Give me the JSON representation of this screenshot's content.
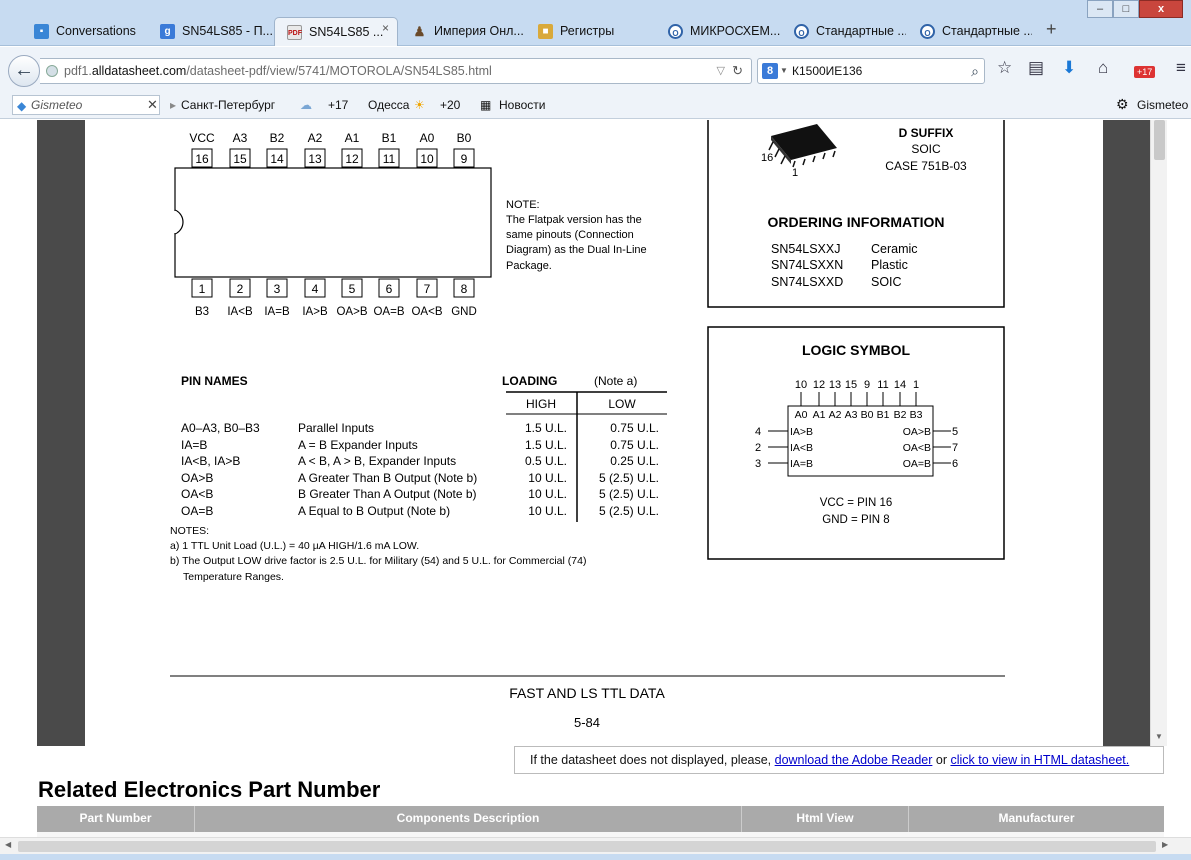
{
  "tabs": [
    {
      "label": "Conversations",
      "icon": "chat-icon"
    },
    {
      "label": "SN54LS85 - П...",
      "icon": "google-icon"
    },
    {
      "label": "SN54LS85 ...",
      "icon": "pdf-icon",
      "active": true
    },
    {
      "label": "Империя Онл...",
      "icon": "figure-icon"
    },
    {
      "label": "Регистры",
      "icon": "package-icon"
    },
    {
      "label": "МИКРОСХЕМ...",
      "icon": "opera-icon"
    },
    {
      "label": "Стандартные ...",
      "icon": "opera-icon"
    },
    {
      "label": "Стандартные ...",
      "icon": "opera-icon"
    }
  ],
  "tab_close_glyph": "×",
  "new_tab_glyph": "+",
  "window": {
    "minimize": "–",
    "maximize": "□",
    "close": "x"
  },
  "nav": {
    "url_scheme_host_prefix": "pdf1.",
    "url_host": "alldatasheet.com",
    "url_path": "/datasheet-pdf/view/5741/MOTOROLA/SN54LS85.html",
    "search_engine_letter": "8",
    "search_value": "К1500ИЕ136",
    "download_badge": "+17"
  },
  "bookmarks": {
    "gismeteo_placeholder": "Gismeteo",
    "items": [
      {
        "label": "Санкт-Петербург"
      },
      {
        "label": "+17"
      },
      {
        "label": "Одесса"
      },
      {
        "label": "+20"
      },
      {
        "label": "Новости"
      },
      {
        "label": "Gismeteo"
      }
    ]
  },
  "chip": {
    "top_pin_labels": [
      "VCC",
      "A3",
      "B2",
      "A2",
      "A1",
      "B1",
      "A0",
      "B0"
    ],
    "top_pin_numbers": [
      "16",
      "15",
      "14",
      "13",
      "12",
      "11",
      "10",
      "9"
    ],
    "bottom_pin_numbers": [
      "1",
      "2",
      "3",
      "4",
      "5",
      "6",
      "7",
      "8"
    ],
    "bottom_pin_labels": [
      "B3",
      "IA<B",
      "IA=B",
      "IA>B",
      "OA>B",
      "OA=B",
      "OA<B",
      "GND"
    ],
    "note_title": "NOTE:",
    "note_lines": [
      "The Flatpak version has the",
      "same pinouts (Connection",
      "Diagram) as the Dual In-Line",
      "Package."
    ]
  },
  "package": {
    "pin16": "16",
    "pin1": "1",
    "suffix": "D SUFFIX",
    "type": "SOIC",
    "case": "CASE 751B-03",
    "ordering_title": "ORDERING INFORMATION",
    "ordering": [
      {
        "part": "SN54LSXXJ",
        "package": "Ceramic"
      },
      {
        "part": "SN74LSXXN",
        "package": "Plastic"
      },
      {
        "part": "SN74LSXXD",
        "package": "SOIC"
      }
    ]
  },
  "pin_names": {
    "title": "PIN NAMES",
    "loading_title": "LOADING",
    "loading_note": "(Note a)",
    "col_high": "HIGH",
    "col_low": "LOW",
    "rows": [
      {
        "pin": "A0–A3, B0–B3",
        "desc": "Parallel Inputs",
        "high": "1.5 U.L.",
        "low": "0.75 U.L."
      },
      {
        "pin": "IA=B",
        "desc": "A = B Expander Inputs",
        "high": "1.5 U.L.",
        "low": "0.75 U.L."
      },
      {
        "pin": "IA<B, IA>B",
        "desc": "A < B, A > B, Expander Inputs",
        "high": "0.5 U.L.",
        "low": "0.25 U.L."
      },
      {
        "pin": "OA>B",
        "desc": "A Greater Than B Output (Note b)",
        "high": "10 U.L.",
        "low": "5 (2.5) U.L."
      },
      {
        "pin": "OA<B",
        "desc": "B Greater Than A Output (Note b)",
        "high": "10 U.L.",
        "low": "5 (2.5) U.L."
      },
      {
        "pin": "OA=B",
        "desc": "A Equal to B Output (Note b)",
        "high": "10 U.L.",
        "low": "5 (2.5) U.L."
      }
    ],
    "notes_title": "NOTES:",
    "note_a": "a) 1 TTL Unit Load (U.L.) = 40 µA HIGH/1.6 mA LOW.",
    "note_b1": "b) The Output LOW drive factor is 2.5 U.L. for Military (54) and 5 U.L. for Commercial (74)",
    "note_b2": "Temperature Ranges."
  },
  "logic_symbol": {
    "title": "LOGIC SYMBOL",
    "top_numbers": [
      "10",
      "12",
      "13",
      "15",
      "9",
      "11",
      "14",
      "1"
    ],
    "top_inner": [
      "A0",
      "A1",
      "A2",
      "A3",
      "B0",
      "B1",
      "B2",
      "B3"
    ],
    "left": [
      {
        "num": "4",
        "label": "IA>B"
      },
      {
        "num": "2",
        "label": "IA<B"
      },
      {
        "num": "3",
        "label": "IA=B"
      }
    ],
    "right": [
      {
        "num": "5",
        "label": "OA>B"
      },
      {
        "num": "7",
        "label": "OA<B"
      },
      {
        "num": "6",
        "label": "OA=B"
      }
    ],
    "vcc": "VCC = PIN 16",
    "gnd": "GND = PIN 8"
  },
  "footer": {
    "title": "FAST AND LS TTL DATA",
    "page": "5-84"
  },
  "viewer_msg": {
    "prefix": "If the datasheet does not displayed, please, ",
    "link1": "download the Adobe Reader",
    "middle": " or ",
    "link2": "click to view in HTML datasheet."
  },
  "related": {
    "title": "Related Electronics Part Number",
    "columns": [
      "Part Number",
      "Components Description",
      "Html View",
      "Manufacturer"
    ]
  }
}
